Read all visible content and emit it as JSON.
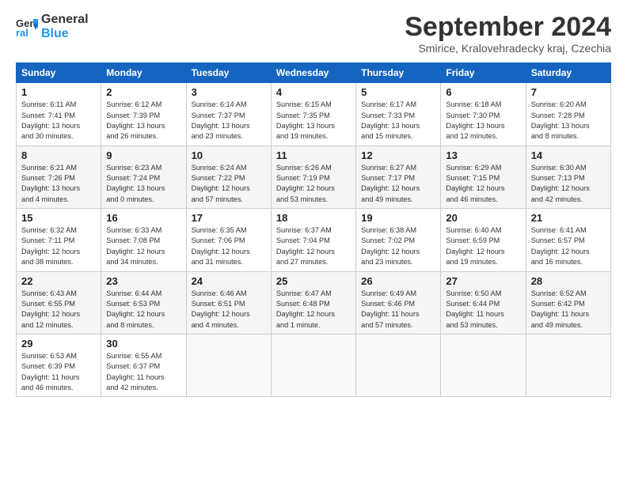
{
  "logo": {
    "line1": "General",
    "line2": "Blue"
  },
  "title": "September 2024",
  "location": "Smirice, Kralovehradecky kraj, Czechia",
  "days_header": [
    "Sunday",
    "Monday",
    "Tuesday",
    "Wednesday",
    "Thursday",
    "Friday",
    "Saturday"
  ],
  "weeks": [
    [
      {
        "num": "1",
        "info": "Sunrise: 6:11 AM\nSunset: 7:41 PM\nDaylight: 13 hours\nand 30 minutes."
      },
      {
        "num": "2",
        "info": "Sunrise: 6:12 AM\nSunset: 7:39 PM\nDaylight: 13 hours\nand 26 minutes."
      },
      {
        "num": "3",
        "info": "Sunrise: 6:14 AM\nSunset: 7:37 PM\nDaylight: 13 hours\nand 23 minutes."
      },
      {
        "num": "4",
        "info": "Sunrise: 6:15 AM\nSunset: 7:35 PM\nDaylight: 13 hours\nand 19 minutes."
      },
      {
        "num": "5",
        "info": "Sunrise: 6:17 AM\nSunset: 7:33 PM\nDaylight: 13 hours\nand 15 minutes."
      },
      {
        "num": "6",
        "info": "Sunrise: 6:18 AM\nSunset: 7:30 PM\nDaylight: 13 hours\nand 12 minutes."
      },
      {
        "num": "7",
        "info": "Sunrise: 6:20 AM\nSunset: 7:28 PM\nDaylight: 13 hours\nand 8 minutes."
      }
    ],
    [
      {
        "num": "8",
        "info": "Sunrise: 6:21 AM\nSunset: 7:26 PM\nDaylight: 13 hours\nand 4 minutes."
      },
      {
        "num": "9",
        "info": "Sunrise: 6:23 AM\nSunset: 7:24 PM\nDaylight: 13 hours\nand 0 minutes."
      },
      {
        "num": "10",
        "info": "Sunrise: 6:24 AM\nSunset: 7:22 PM\nDaylight: 12 hours\nand 57 minutes."
      },
      {
        "num": "11",
        "info": "Sunrise: 6:26 AM\nSunset: 7:19 PM\nDaylight: 12 hours\nand 53 minutes."
      },
      {
        "num": "12",
        "info": "Sunrise: 6:27 AM\nSunset: 7:17 PM\nDaylight: 12 hours\nand 49 minutes."
      },
      {
        "num": "13",
        "info": "Sunrise: 6:29 AM\nSunset: 7:15 PM\nDaylight: 12 hours\nand 46 minutes."
      },
      {
        "num": "14",
        "info": "Sunrise: 6:30 AM\nSunset: 7:13 PM\nDaylight: 12 hours\nand 42 minutes."
      }
    ],
    [
      {
        "num": "15",
        "info": "Sunrise: 6:32 AM\nSunset: 7:11 PM\nDaylight: 12 hours\nand 38 minutes."
      },
      {
        "num": "16",
        "info": "Sunrise: 6:33 AM\nSunset: 7:08 PM\nDaylight: 12 hours\nand 34 minutes."
      },
      {
        "num": "17",
        "info": "Sunrise: 6:35 AM\nSunset: 7:06 PM\nDaylight: 12 hours\nand 31 minutes."
      },
      {
        "num": "18",
        "info": "Sunrise: 6:37 AM\nSunset: 7:04 PM\nDaylight: 12 hours\nand 27 minutes."
      },
      {
        "num": "19",
        "info": "Sunrise: 6:38 AM\nSunset: 7:02 PM\nDaylight: 12 hours\nand 23 minutes."
      },
      {
        "num": "20",
        "info": "Sunrise: 6:40 AM\nSunset: 6:59 PM\nDaylight: 12 hours\nand 19 minutes."
      },
      {
        "num": "21",
        "info": "Sunrise: 6:41 AM\nSunset: 6:57 PM\nDaylight: 12 hours\nand 16 minutes."
      }
    ],
    [
      {
        "num": "22",
        "info": "Sunrise: 6:43 AM\nSunset: 6:55 PM\nDaylight: 12 hours\nand 12 minutes."
      },
      {
        "num": "23",
        "info": "Sunrise: 6:44 AM\nSunset: 6:53 PM\nDaylight: 12 hours\nand 8 minutes."
      },
      {
        "num": "24",
        "info": "Sunrise: 6:46 AM\nSunset: 6:51 PM\nDaylight: 12 hours\nand 4 minutes."
      },
      {
        "num": "25",
        "info": "Sunrise: 6:47 AM\nSunset: 6:48 PM\nDaylight: 12 hours\nand 1 minute."
      },
      {
        "num": "26",
        "info": "Sunrise: 6:49 AM\nSunset: 6:46 PM\nDaylight: 11 hours\nand 57 minutes."
      },
      {
        "num": "27",
        "info": "Sunrise: 6:50 AM\nSunset: 6:44 PM\nDaylight: 11 hours\nand 53 minutes."
      },
      {
        "num": "28",
        "info": "Sunrise: 6:52 AM\nSunset: 6:42 PM\nDaylight: 11 hours\nand 49 minutes."
      }
    ],
    [
      {
        "num": "29",
        "info": "Sunrise: 6:53 AM\nSunset: 6:39 PM\nDaylight: 11 hours\nand 46 minutes."
      },
      {
        "num": "30",
        "info": "Sunrise: 6:55 AM\nSunset: 6:37 PM\nDaylight: 11 hours\nand 42 minutes."
      },
      {
        "num": "",
        "info": ""
      },
      {
        "num": "",
        "info": ""
      },
      {
        "num": "",
        "info": ""
      },
      {
        "num": "",
        "info": ""
      },
      {
        "num": "",
        "info": ""
      }
    ]
  ]
}
